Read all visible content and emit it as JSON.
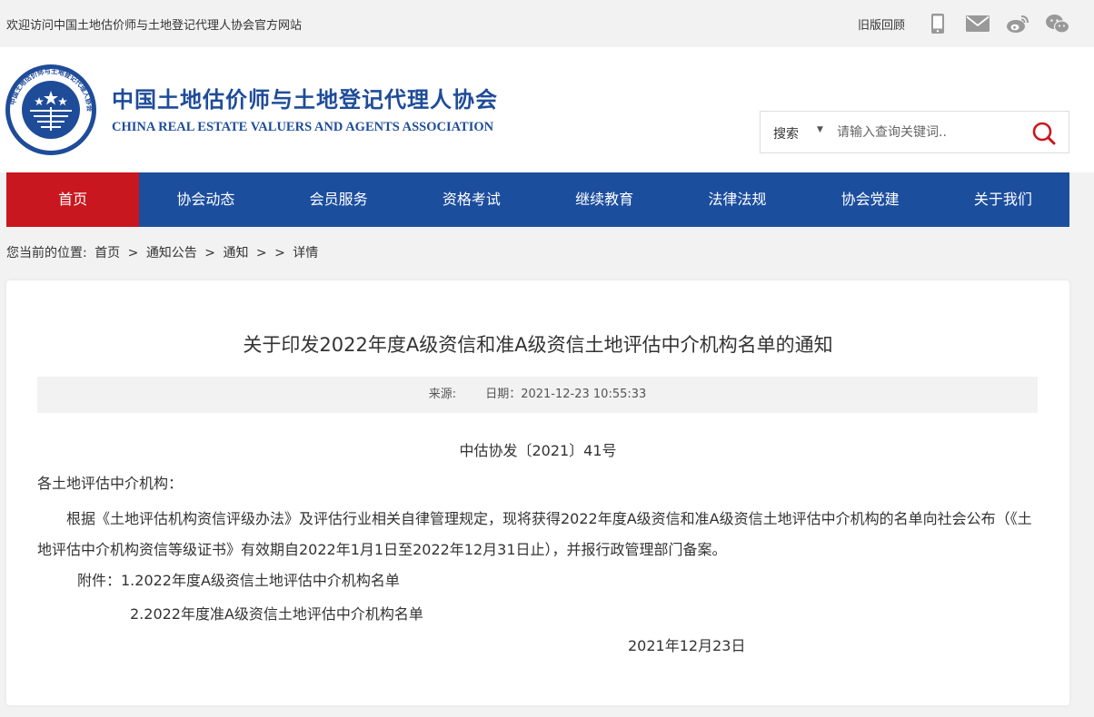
{
  "topbar": {
    "welcome": "欢迎访问中国土地估价师与土地登记代理人协会官方网站",
    "old_site": "旧版回顾",
    "icons": [
      "mobile-icon",
      "mail-icon",
      "weibo-icon",
      "wechat-icon"
    ]
  },
  "header": {
    "title_cn": "中国土地估价师与土地登记代理人协会",
    "title_en": "CHINA REAL ESTATE VALUERS AND AGENTS ASSOCIATION",
    "logo_text": "中国土地估价师与土地登记代理人协会"
  },
  "search": {
    "scope": "搜索",
    "placeholder": "请输入查询关键词.."
  },
  "nav": {
    "items": [
      {
        "label": "首页"
      },
      {
        "label": "协会动态"
      },
      {
        "label": "会员服务"
      },
      {
        "label": "资格考试"
      },
      {
        "label": "继续教育"
      },
      {
        "label": "法律法规"
      },
      {
        "label": "协会党建"
      },
      {
        "label": "关于我们"
      }
    ],
    "active_index": 0
  },
  "breadcrumb": {
    "prefix": "您当前的位置:",
    "items": [
      "首页",
      ">",
      "通知公告",
      ">",
      "通知",
      ">",
      ">",
      "详情"
    ]
  },
  "article": {
    "title": "关于印发2022年度A级资信和准A级资信土地评估中介机构名单的通知",
    "source_label": "来源:",
    "date_label": "日期：2021-12-23 10:55:33",
    "doc_number": "中估协发〔2021〕41号",
    "salutation": "各土地评估中介机构：",
    "body": "根据《土地评估机构资信评级办法》及评估行业相关自律管理规定，现将获得2022年度A级资信和准A级资信土地评估中介机构的名单向社会公布（《土地评估中介机构资信等级证书》有效期自2022年1月1日至2022年12月31日止），并报行政管理部门备案。",
    "attachment_1": "附件：1.2022年度A级资信土地评估中介机构名单",
    "attachment_2": "2.2022年度准A级资信土地评估中介机构名单",
    "signed_date": "2021年12月23日"
  },
  "colors": {
    "nav_bg": "#1c4e9e",
    "nav_active": "#c8171e",
    "brand_blue": "#1f4c99",
    "search_icon": "#c8171e"
  }
}
